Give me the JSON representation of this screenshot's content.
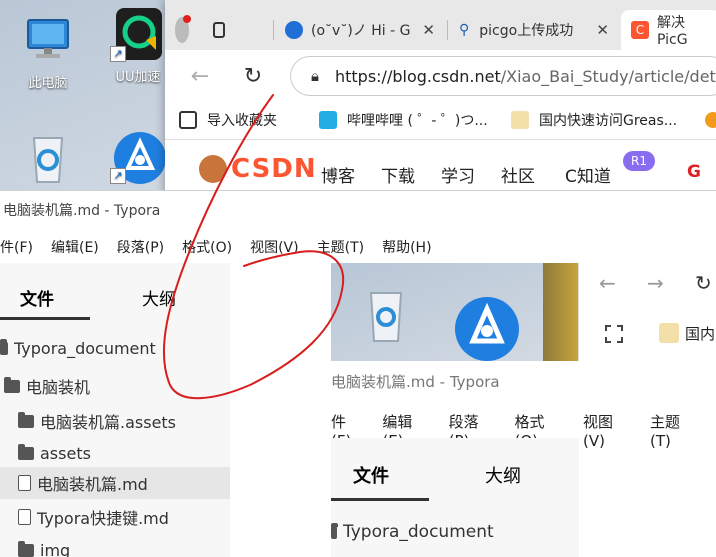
{
  "desktop": {
    "icons": [
      {
        "label": "此电脑",
        "icon": "computer-icon"
      },
      {
        "label": "UU加速",
        "icon": "uu-accelerator-icon"
      },
      {
        "label": "",
        "icon": "recycle-bin-icon"
      },
      {
        "label": "",
        "icon": "app-shortcut-icon"
      }
    ]
  },
  "browser": {
    "tabs": [
      {
        "title": "(o˘v˘)ノ Hi - G",
        "close": "✕"
      },
      {
        "title": "picgo上传成功",
        "close": "✕"
      },
      {
        "title": "解决PicG",
        "close": ""
      }
    ],
    "nav": {
      "back": "←",
      "refresh": "↻"
    },
    "url": {
      "host": "https://blog.csdn.net",
      "path": "/Xiao_Bai_Study/article/det"
    },
    "favorites": [
      {
        "label": "导入收藏夹"
      },
      {
        "label": "哔哩哔哩 ( ゜- ゜)つ..."
      },
      {
        "label": "国内快速访问Greas..."
      }
    ],
    "csdn": {
      "logo": "CSDN",
      "nav": [
        "博客",
        "下载",
        "学习",
        "社区",
        "C知道"
      ],
      "badge": "R1",
      "extra": "G"
    }
  },
  "typora": {
    "title": "电脑装机篇.md - Typora",
    "menu": [
      "件(F)",
      "编辑(E)",
      "段落(P)",
      "格式(O)",
      "视图(V)",
      "主题(T)",
      "帮助(H)"
    ],
    "sidebar": {
      "tabs": [
        "文件",
        "大纲"
      ],
      "tree": [
        {
          "label": "Typora_document",
          "type": "folder"
        },
        {
          "label": "电脑装机",
          "type": "folder-open"
        },
        {
          "label": "电脑装机篇.assets",
          "type": "folder"
        },
        {
          "label": "assets",
          "type": "folder"
        },
        {
          "label": "电脑装机篇.md",
          "type": "file",
          "selected": true
        },
        {
          "label": "Typora快捷键.md",
          "type": "file"
        },
        {
          "label": "img",
          "type": "folder"
        }
      ]
    }
  },
  "nested": {
    "nav": {
      "back": "←",
      "forward": "→",
      "refresh": "↻"
    },
    "partial_text": "国内",
    "title": "电脑装机篇.md - Typora",
    "menu": [
      "件(F)",
      "编辑(E)",
      "段落(P)",
      "格式(O)",
      "视图(V)",
      "主题(T)"
    ],
    "sidebar": {
      "tabs": [
        "文件",
        "大纲"
      ],
      "tree": [
        {
          "label": "Typora_document"
        }
      ]
    }
  },
  "colors": {
    "csdn_red": "#fc5531",
    "badge_purple": "#8a6cf0",
    "annotation_red": "#d91c1c"
  }
}
